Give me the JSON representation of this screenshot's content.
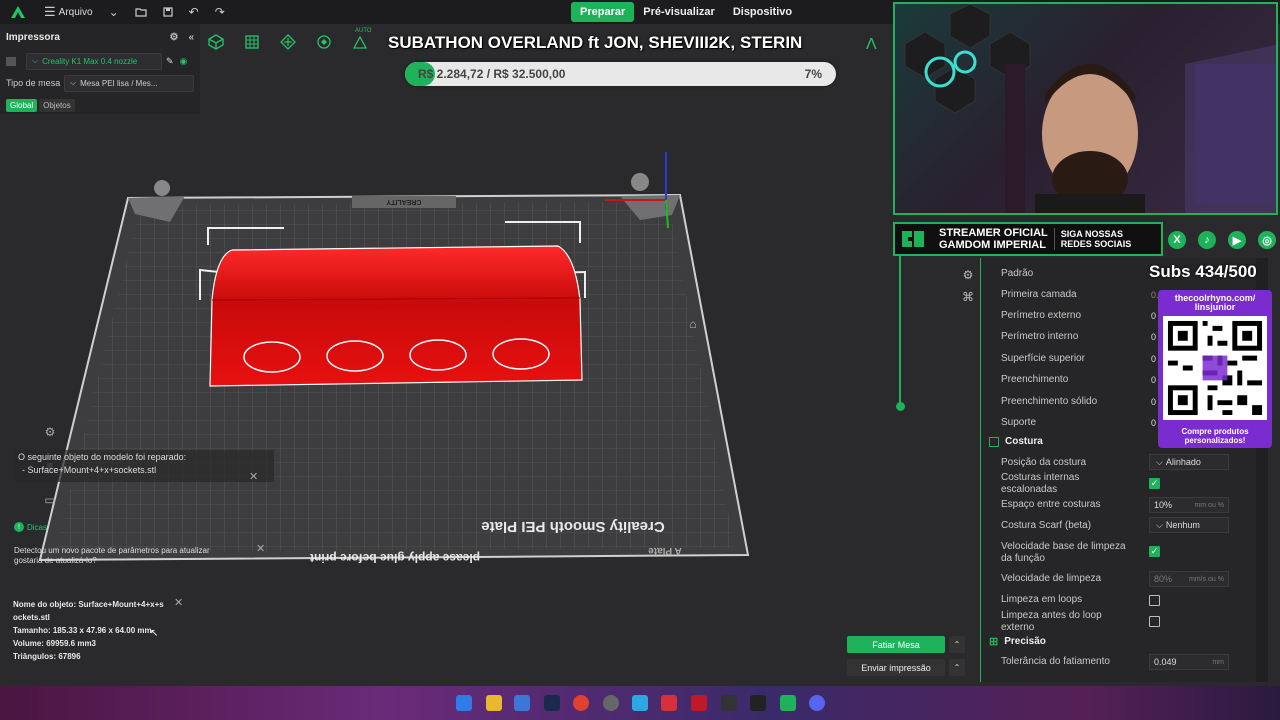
{
  "topbar": {
    "menu_label": "Arquivo",
    "tabs": [
      "Preparar",
      "Pré-visualizar",
      "Dispositivo"
    ]
  },
  "left_panel": {
    "title": "Impressora",
    "printer": "Creality K1 Max 0.4 nozzle",
    "plate_label": "Tipo de mesa",
    "plate_value": "Mesa PEI lisa / Mes...",
    "chip_global": "Global",
    "chip_objects": "Objetos"
  },
  "overlay": {
    "title": "SUBATHON OVERLAND ft JON, SHEVIII2K, STERIN",
    "amount_text": "R$ 2.284,72 / R$ 32.500,00",
    "percent_text": "7%",
    "progress": 0.07
  },
  "scene": {
    "plate_text": "Creality Smooth PEI Plate",
    "glue_text": "please apply glue before print",
    "plate_name": "A Plate",
    "brand": "CREALITY",
    "auto_label": "AUTO"
  },
  "notifications": {
    "repaired_title": "O seguinte objeto do modelo foi reparado:",
    "repaired_item": "- Surface+Mount+4+x+sockets.stl",
    "tips_label": "Dicas",
    "update_text": "Detectou um novo pacote de parâmetros para atualizar",
    "update_text2": "gostaria de atualizá-lo?"
  },
  "object_info": {
    "name_line1": "Nome do objeto: Surface+Mount+4+x+s",
    "name_line2": "ockets.stl",
    "size": "Tamanho: 185.33 x 47.96 x 64.00 mm",
    "volume": "Volume: 69959.6 mm3",
    "triangles": "Triângulos: 67896"
  },
  "buttons": {
    "slice": "Fatiar Mesa",
    "send": "Enviar impressão"
  },
  "settings": {
    "profile": "Padrão",
    "items": [
      "Primeira camada",
      "Perímetro externo",
      "Perímetro interno",
      "Superfície superior",
      "Preenchimento",
      "Preenchimento sólido",
      "Suporte"
    ],
    "value_prefix": "0",
    "first_layer_value": "0.5",
    "seam_section": "Costura",
    "seam_position_label": "Posição da costura",
    "seam_position_value": "Alinhado",
    "staggered_label_1": "Costuras internas",
    "staggered_label_2": "escalonadas",
    "seam_gap_label": "Espaço entre costuras",
    "seam_gap_value": "10%",
    "seam_gap_unit": "mm ou %",
    "scarf_label": "Costura Scarf (beta)",
    "scarf_value": "Nenhum",
    "wipe_base_label_1": "Velocidade base de limpeza",
    "wipe_base_label_2": "da função",
    "wipe_speed_label": "Velocidade de limpeza",
    "wipe_speed_value": "80%",
    "wipe_speed_unit": "mm/s ou %",
    "wipe_loops_label": "Limpeza em loops",
    "wipe_before_label_1": "Limpeza antes do loop",
    "wipe_before_label_2": "externo",
    "precision_section": "Precisão",
    "tolerance_label": "Tolerância do fatiamento",
    "tolerance_value": "0.049",
    "tolerance_unit": "mm"
  },
  "stream": {
    "banner_line1": "STREAMER OFICIAL",
    "banner_line2": "GAMDOM IMPERIAL",
    "banner_social_1": "SIGA NOSSAS",
    "banner_social_2": "REDES SOCIAIS",
    "subs": "Subs 434/500",
    "qr_title_1": "thecoolrhyno.com/",
    "qr_title_2": "linsjunior",
    "qr_foot_1": "Compre produtos",
    "qr_foot_2": "personalizados!"
  },
  "colors": {
    "accent": "#1eb35a",
    "model": "#e81010",
    "plate": "#4a4a4c"
  }
}
